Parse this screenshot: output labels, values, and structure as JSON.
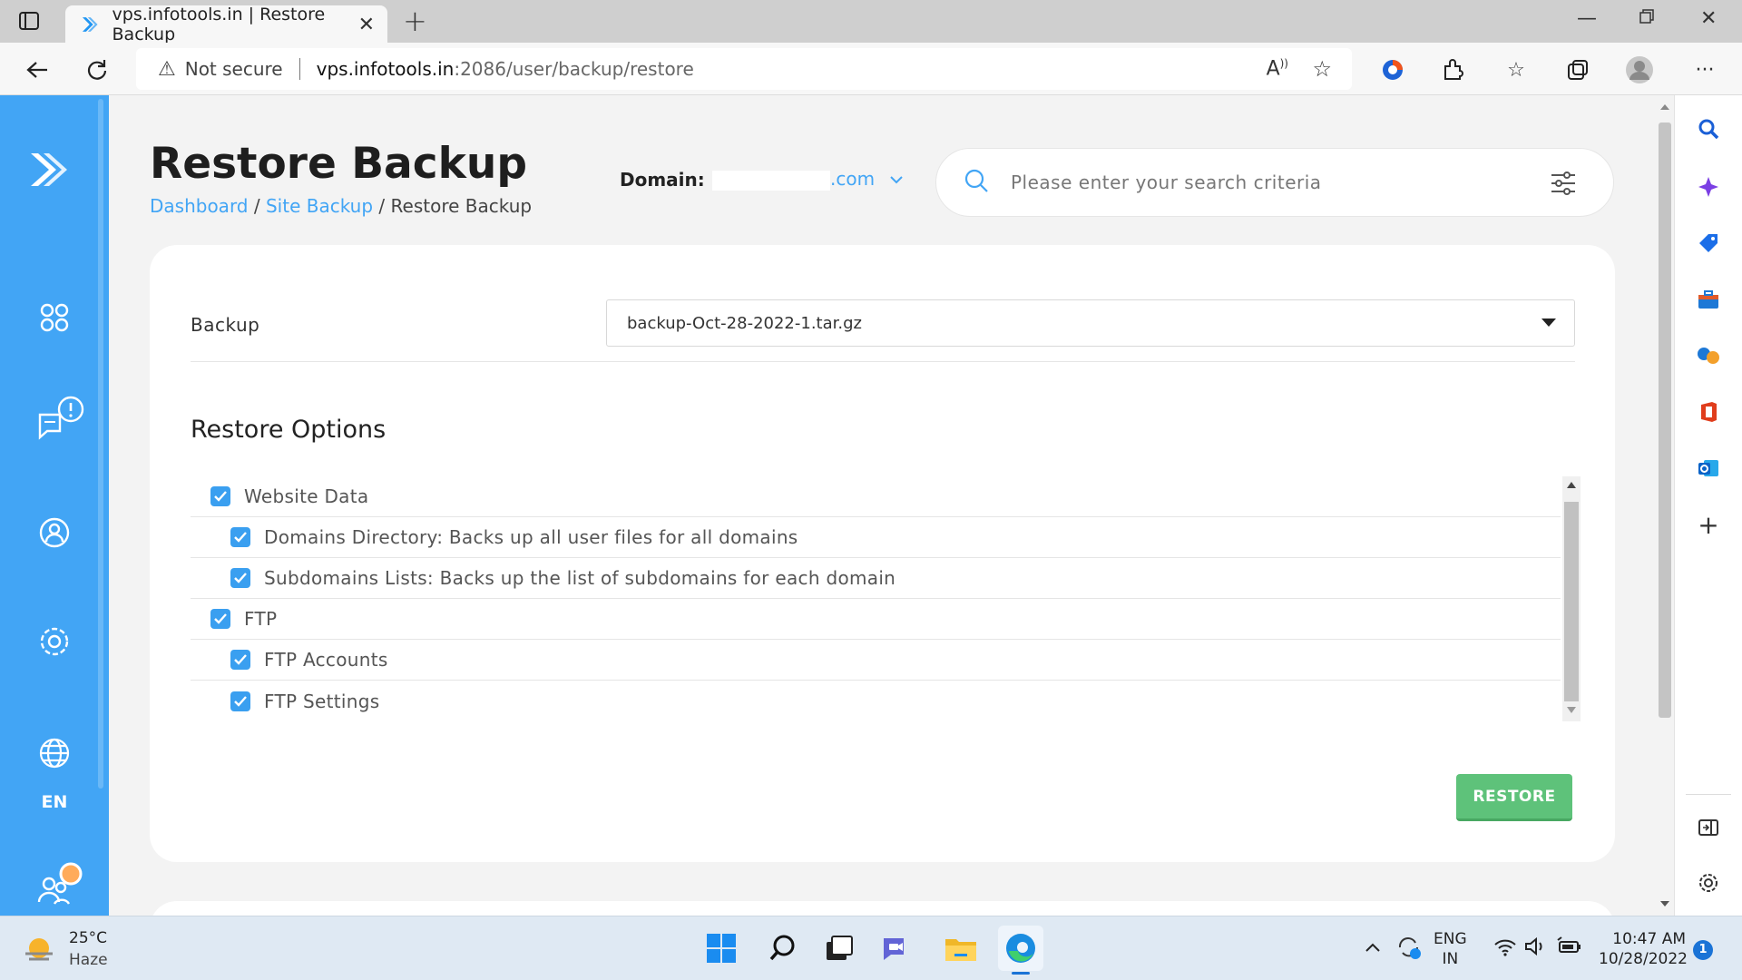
{
  "browser": {
    "tab_title": "vps.infotools.in | Restore Backup",
    "new_tab": "+",
    "security_label": "Not secure",
    "url_host": "vps.infotools.in",
    "url_path": ":2086/user/backup/restore"
  },
  "page": {
    "title": "Restore Backup",
    "breadcrumb": [
      "Dashboard",
      "Site Backup",
      "Restore Backup"
    ],
    "domain_label": "Domain:",
    "domain_suffix": ".com",
    "search_placeholder": "Please enter your search criteria"
  },
  "form": {
    "backup_label": "Backup",
    "backup_selected": "backup-Oct-28-2022-1.tar.gz",
    "restore_options_heading": "Restore Options",
    "options": [
      {
        "label": "Website Data",
        "level": 1,
        "checked": true
      },
      {
        "label": "Domains Directory: Backs up all user files for all domains",
        "level": 2,
        "checked": true
      },
      {
        "label": "Subdomains Lists: Backs up the list of subdomains for each domain",
        "level": 2,
        "checked": true
      },
      {
        "label": "FTP",
        "level": 1,
        "checked": true
      },
      {
        "label": "FTP Accounts",
        "level": 2,
        "checked": true
      },
      {
        "label": "FTP Settings",
        "level": 2,
        "checked": true
      }
    ],
    "restore_button": "RESTORE"
  },
  "leftnav": {
    "language": "EN"
  },
  "taskbar": {
    "temperature": "25°C",
    "weather": "Haze",
    "lang_top": "ENG",
    "lang_bottom": "IN",
    "time": "10:47 AM",
    "date": "10/28/2022",
    "notification_count": "1"
  },
  "colors": {
    "accent": "#42a5f5",
    "restore_button": "#5ec27a",
    "checkbox": "#3a9ff0"
  }
}
